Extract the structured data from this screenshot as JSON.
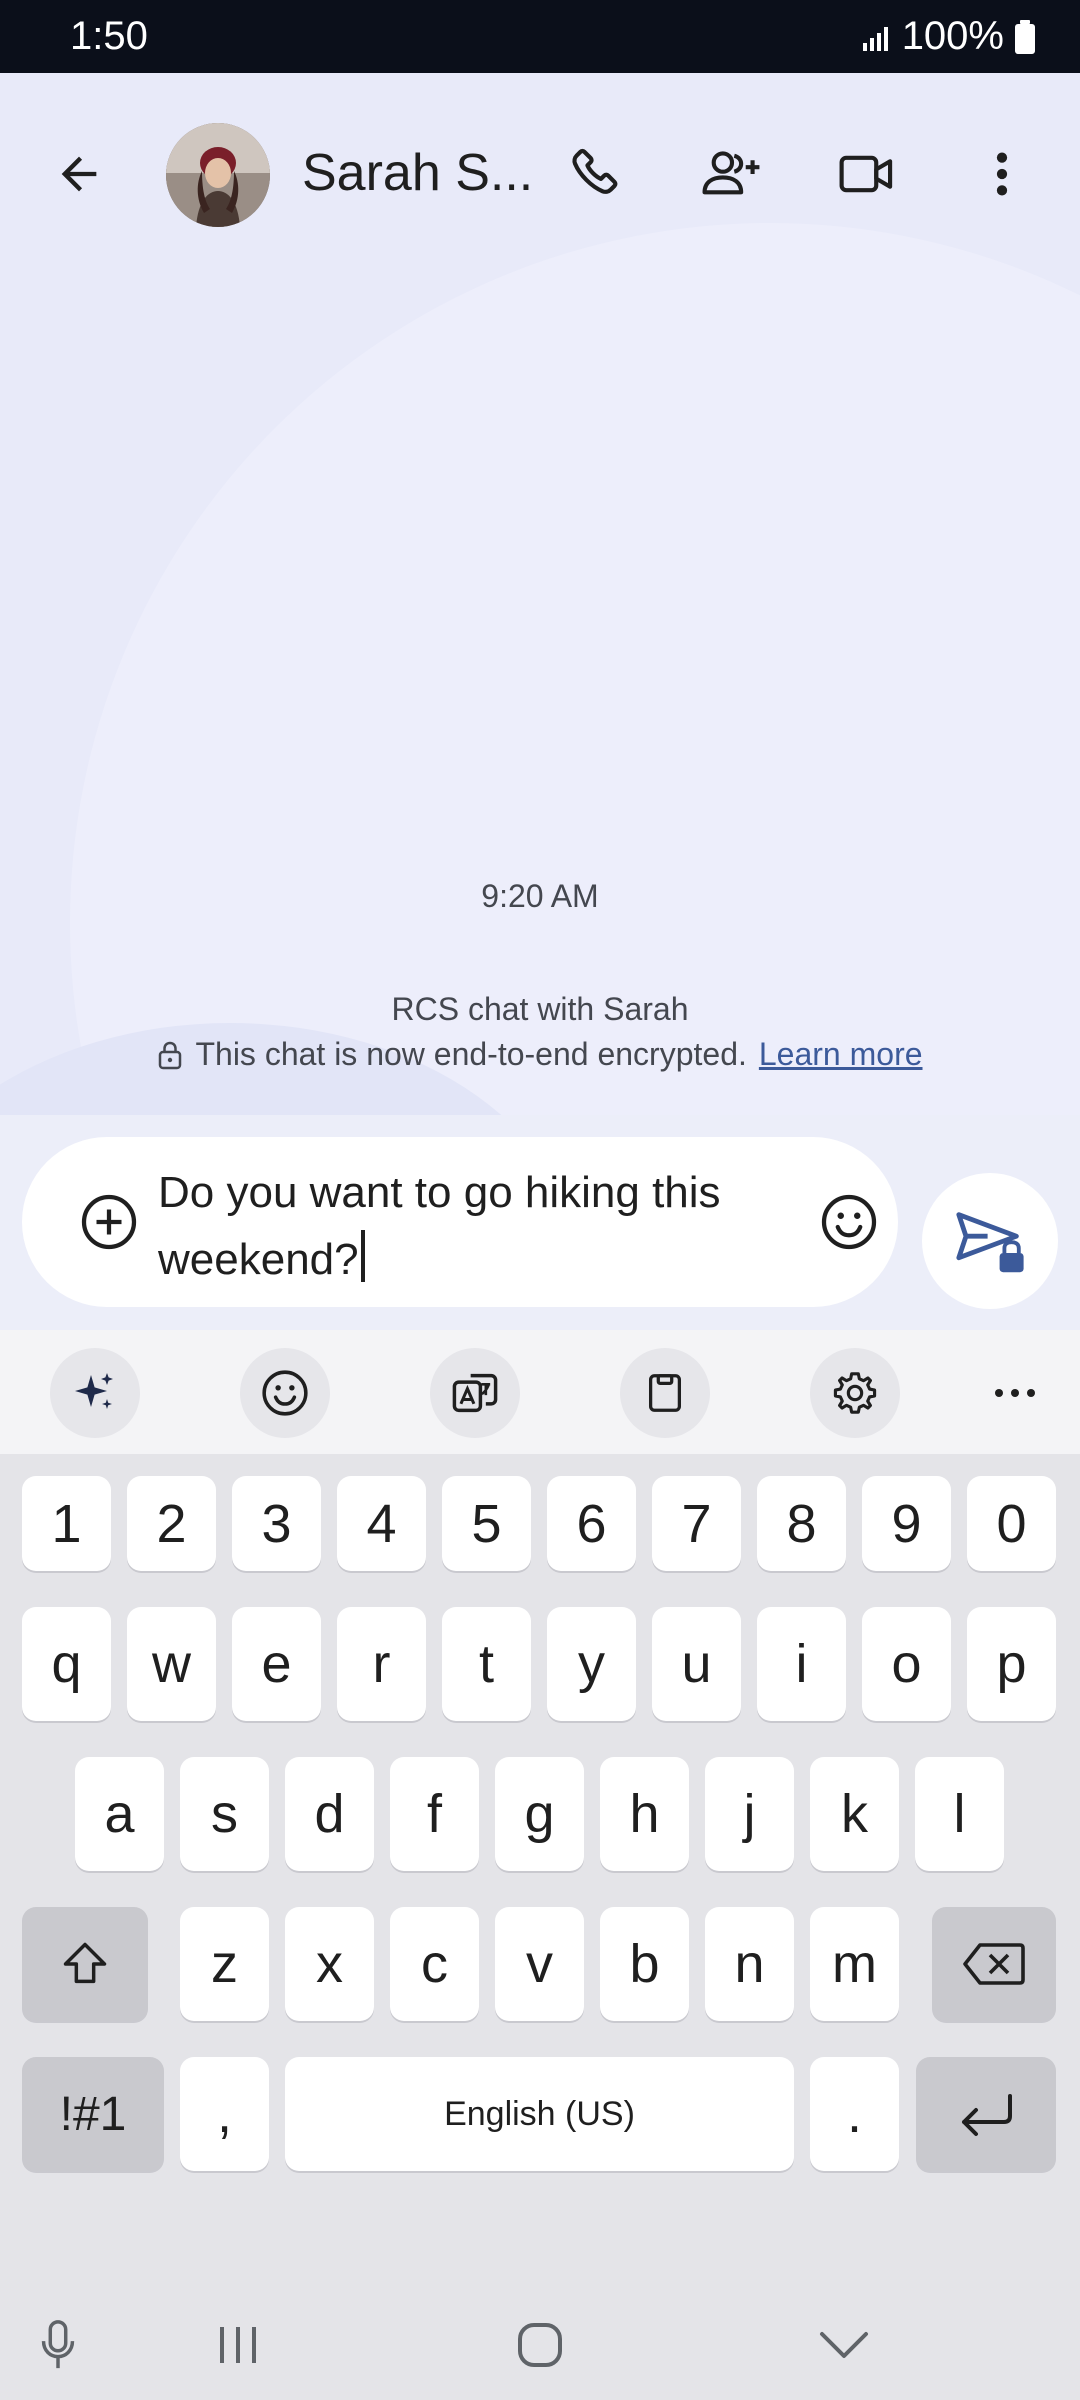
{
  "status_bar": {
    "time": "1:50",
    "battery": "100%"
  },
  "header": {
    "contact_name": "Sarah S..."
  },
  "conversation": {
    "timestamp": "9:20 AM",
    "rcs_notice": "RCS chat with Sarah",
    "encryption_notice": "This chat is now end-to-end encrypted.",
    "learn_more": "Learn more"
  },
  "compose": {
    "line1": "Do you want to go hiking this",
    "line2": "weekend?"
  },
  "keyboard": {
    "number_row": [
      "1",
      "2",
      "3",
      "4",
      "5",
      "6",
      "7",
      "8",
      "9",
      "0"
    ],
    "row1": [
      "q",
      "w",
      "e",
      "r",
      "t",
      "y",
      "u",
      "i",
      "o",
      "p"
    ],
    "row2": [
      "a",
      "s",
      "d",
      "f",
      "g",
      "h",
      "j",
      "k",
      "l"
    ],
    "row3": [
      "z",
      "x",
      "c",
      "v",
      "b",
      "n",
      "m"
    ],
    "symbols_key": "!#1",
    "comma_key": ",",
    "space_label": "English (US)",
    "period_key": "."
  },
  "colors": {
    "accent": "#3c5a9a",
    "status_bar_bg": "#0b0f1a",
    "chat_bg": "#e8eaf9"
  },
  "icons": [
    "back-arrow-icon",
    "phone-icon",
    "add-person-icon",
    "video-icon",
    "more-vert-icon",
    "add-circle-icon",
    "emoji-icon",
    "send-lock-icon",
    "sparkle-icon",
    "emoji-icon",
    "translate-icon",
    "clipboard-icon",
    "gear-icon",
    "more-horiz-icon",
    "shift-icon",
    "backspace-icon",
    "enter-icon",
    "mic-icon",
    "recents-icon",
    "home-icon",
    "hide-keyboard-icon"
  ]
}
